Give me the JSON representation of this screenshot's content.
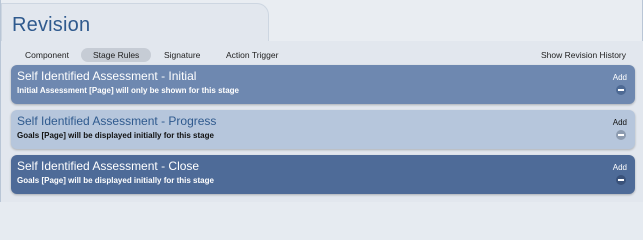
{
  "header": {
    "title": "Revision"
  },
  "tabs": [
    {
      "label": "Component"
    },
    {
      "label": "Stage Rules",
      "active": true
    },
    {
      "label": "Signature"
    },
    {
      "label": "Action Trigger"
    }
  ],
  "history_link": "Show Revision History",
  "panels": [
    {
      "title": "Self Identified Assessment - Initial",
      "subtitle": "Initial Assessment [Page] will only be shown for this stage",
      "add_label": "Add"
    },
    {
      "title": "Self Identified Assessment - Progress",
      "subtitle": "Goals [Page] will be displayed initially for this stage",
      "add_label": "Add"
    },
    {
      "title": "Self Identified Assessment - Close",
      "subtitle": "Goals [Page] will be displayed initially for this stage",
      "add_label": "Add"
    }
  ],
  "icons": {
    "remove": "minus-circle-icon"
  }
}
